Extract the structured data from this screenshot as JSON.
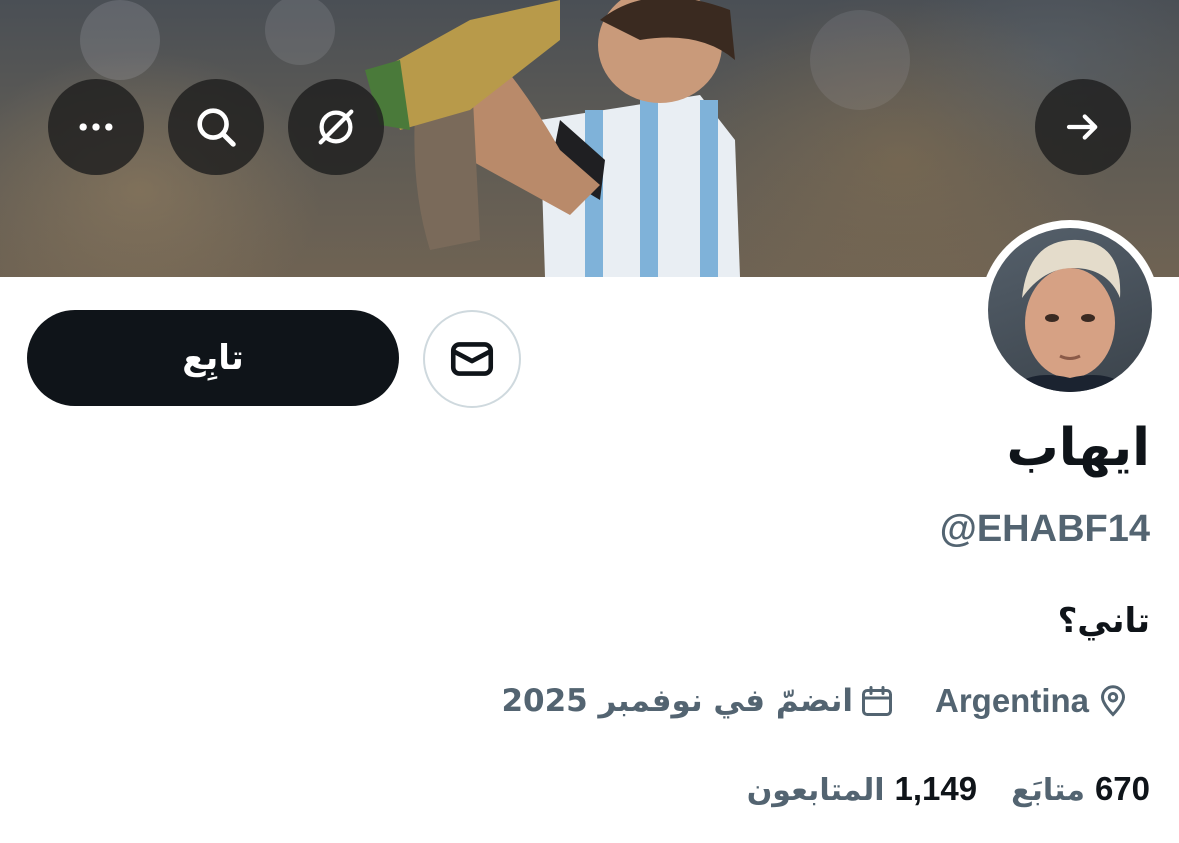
{
  "header": {
    "banner_image": "banner-photo",
    "buttons": {
      "back_icon": "arrow-right-icon",
      "grok_icon": "grok-icon",
      "search_icon": "search-icon",
      "more_icon": "more-icon"
    }
  },
  "profile": {
    "display_name": "ايهاب",
    "handle": "@EHABF14",
    "bio": "تاني؟",
    "location": "Argentina",
    "joined": "انضمّ في نوفمبر 2025",
    "avatar_image": "avatar-photo"
  },
  "actions": {
    "follow_label": "تابِع",
    "message_icon": "envelope-icon"
  },
  "stats": {
    "following_count": "670",
    "following_label": "متابَع",
    "followers_count": "1,149",
    "followers_label": "المتابعون"
  },
  "colors": {
    "primary_text": "#0f1419",
    "secondary_text": "#536471",
    "button_dark": "#0f1419",
    "border": "#cfd9de"
  }
}
